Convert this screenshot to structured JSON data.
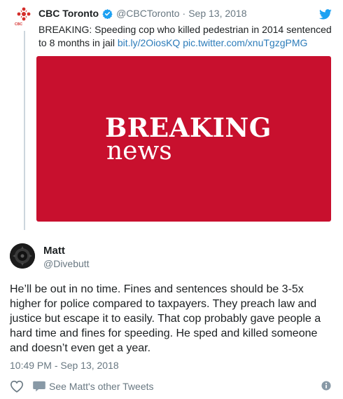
{
  "parent_tweet": {
    "author_name": "CBC Toronto",
    "logo_text": "CBC",
    "handle": "@CBCToronto",
    "separator": "·",
    "date": "Sep 13, 2018",
    "text_prefix": "BREAKING: Speeding cop who killed pedestrian in 2014 sentenced to 8 months in jail ",
    "link_1": "bit.ly/2OiosKQ",
    "link_2": "pic.twitter.com/xnuTgzgPMG",
    "image": {
      "title": "BREAKING",
      "subtitle": "news",
      "background_color": "#c8102e"
    },
    "icons": [
      "cbc-logo-icon",
      "verified-badge-icon",
      "twitter-bird-icon"
    ]
  },
  "reply_tweet": {
    "author_name": "Matt",
    "handle": "@Divebutt",
    "text": "He’ll be out in no time. Fines and sentences should be 3-5x higher for police compared to taxpayers. They preach law and justice but escape it to easily. That cop probably gave people a hard time and fines for speeding. He sped and killed someone and doesn’t even get a year.",
    "timestamp": "10:49 PM - Sep 13, 2018",
    "actions": {
      "see_other_tweets": "See Matt's other Tweets"
    },
    "icons": [
      "avatar",
      "heart-icon",
      "speech-bubble-icon",
      "info-icon"
    ]
  },
  "colors": {
    "link": "#2b7bb9",
    "secondary_text": "#697882",
    "verified": "#1da1f2",
    "twitter_blue": "#1da1f2"
  }
}
